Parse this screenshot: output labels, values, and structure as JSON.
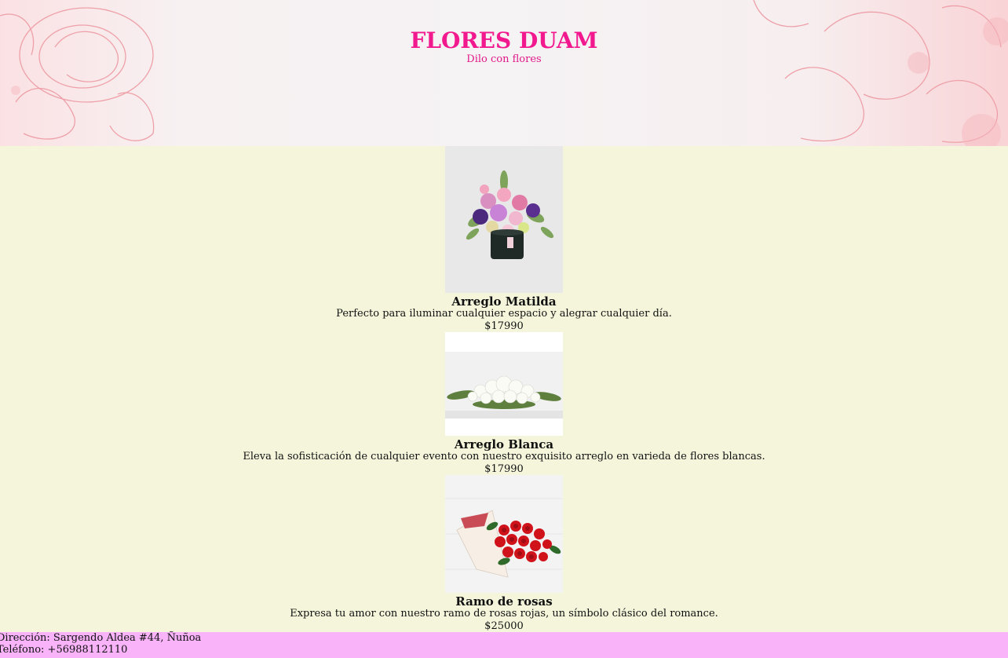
{
  "header": {
    "brand": "FLORES DUAM",
    "tagline": "Dilo con flores"
  },
  "products": [
    {
      "name": "Arreglo Matilda",
      "description": "Perfecto para iluminar cualquier espacio y alegrar cualquier día.",
      "price": "$17990",
      "image": "bouquet-in-black-box"
    },
    {
      "name": "Arreglo Blanca",
      "description": "Eleva la sofisticación de cualquier evento con nuestro exquisito arreglo en varieda de flores blancas.",
      "price": "$17990",
      "image": "white-flower-arrangement"
    },
    {
      "name": "Ramo de rosas",
      "description": "Expresa tu amor con nuestro ramo de rosas rojas, un símbolo clásico del romance.",
      "price": "$25000",
      "image": "red-roses-bouquet"
    }
  ],
  "footer": {
    "address": "Dirección: Sargendo Aldea #44, Ñuñoa",
    "phone": "Teléfono: +56988112110"
  },
  "colors": {
    "brand": "#f2198f",
    "page_background": "#f5f5dc",
    "footer_background": "#f9b3f9"
  }
}
